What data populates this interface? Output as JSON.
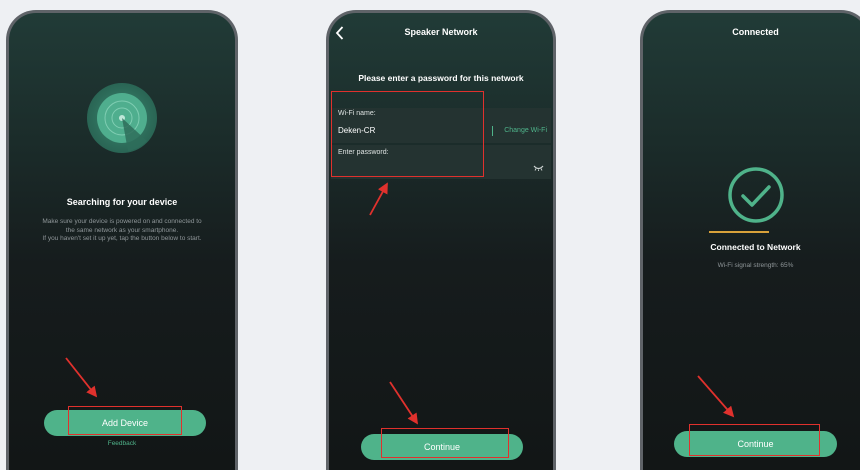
{
  "screen1": {
    "title": "Searching for your device",
    "line1": "Make sure your device is powered on and connected to",
    "line2": "the same network as your smartphone.",
    "line3": "If you haven't set it up yet, tap the button below to start.",
    "button_label": "Add Device",
    "feedback_label": "Feedback"
  },
  "screen2": {
    "nav_title": "Speaker Network",
    "prompt": "Please enter a password for this network",
    "wifi_label": "Wi-Fi name:",
    "wifi_value": "Deken-CR",
    "change_wifi": "Change Wi-Fi",
    "password_label": "Enter password:",
    "button_label": "Continue"
  },
  "screen3": {
    "nav_title": "Connected",
    "status": "Connected to Network",
    "signal_text": "Wi-Fi signal strength: 65%",
    "button_label": "Continue"
  },
  "colors": {
    "accent": "#4fb38a",
    "highlight": "#e0312d",
    "divider": "#d8a13a"
  }
}
